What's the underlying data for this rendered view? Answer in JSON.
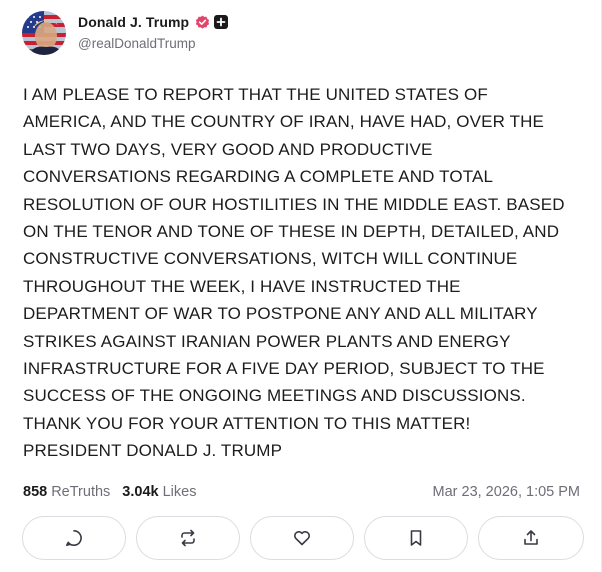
{
  "profile": {
    "display_name": "Donald J. Trump",
    "handle": "@realDonaldTrump",
    "verified_icon": "verified-badge-icon",
    "plus_icon": "plus-badge-icon"
  },
  "post": {
    "text": "I AM PLEASE TO REPORT THAT THE UNITED STATES OF\nAMERICA, AND THE COUNTRY OF IRAN, HAVE HAD, OVER THE\nLAST TWO DAYS, VERY GOOD AND PRODUCTIVE\nCONVERSATIONS REGARDING A COMPLETE AND TOTAL\nRESOLUTION OF OUR HOSTILITIES IN THE MIDDLE EAST. BASED\nON THE TENOR AND TONE OF THESE IN DEPTH, DETAILED, AND\nCONSTRUCTIVE CONVERSATIONS, WITCH WILL CONTINUE\nTHROUGHOUT THE WEEK, I HAVE INSTRUCTED THE\nDEPARTMENT OF WAR TO POSTPONE ANY AND ALL MILITARY\nSTRIKES AGAINST IRANIAN POWER PLANTS AND ENERGY\nINFRASTRUCTURE FOR A FIVE DAY PERIOD, SUBJECT TO THE\nSUCCESS OF THE ONGOING MEETINGS AND DISCUSSIONS.\nTHANK YOU FOR YOUR ATTENTION TO THIS MATTER!\nPRESIDENT DONALD J. TRUMP"
  },
  "stats": {
    "retruths_count": "858",
    "retruths_label": "ReTruths",
    "likes_count": "3.04k",
    "likes_label": "Likes",
    "timestamp": "Mar 23, 2026, 1:05 PM"
  },
  "actions": [
    {
      "name": "reply",
      "icon": "reply-icon"
    },
    {
      "name": "retruth",
      "icon": "retruth-icon"
    },
    {
      "name": "like",
      "icon": "heart-icon"
    },
    {
      "name": "bookmark",
      "icon": "bookmark-icon"
    },
    {
      "name": "share",
      "icon": "share-icon"
    }
  ],
  "colors": {
    "verified": "#e2456a",
    "text": "#1c1c1e",
    "muted": "#6e6e78",
    "border": "#dcdce2"
  }
}
